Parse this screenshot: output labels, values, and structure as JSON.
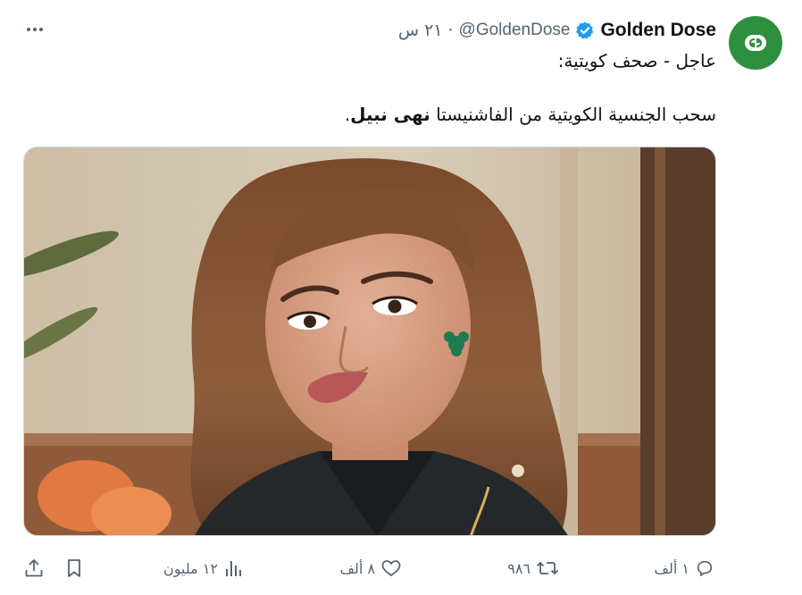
{
  "tweet": {
    "author_name": "Golden Dose",
    "handle": "@GoldenDose",
    "separator": "·",
    "time": "٢١ س",
    "line1": "عاجل - صحف كويتية:",
    "line2_prefix": "سحب الجنسية الكويتية من الفاشنيستا ",
    "line2_bold": "نهى نبيل",
    "line2_suffix": "."
  },
  "metrics": {
    "replies": "١ ألف",
    "retweets": "٩٨٦",
    "likes": "٨ ألف",
    "views": "١٢ مليون"
  },
  "colors": {
    "avatar_bg": "#2e8f3e",
    "verified": "#1d9bf0",
    "muted_text": "#536471",
    "text": "#0f1419"
  },
  "icons": {
    "verified": "verified-badge-icon",
    "more": "more-dots-icon",
    "reply": "reply-bubble-icon",
    "retweet": "retweet-icon",
    "like": "heart-icon",
    "views": "bar-chart-icon",
    "bookmark": "bookmark-icon",
    "share": "share-icon"
  }
}
